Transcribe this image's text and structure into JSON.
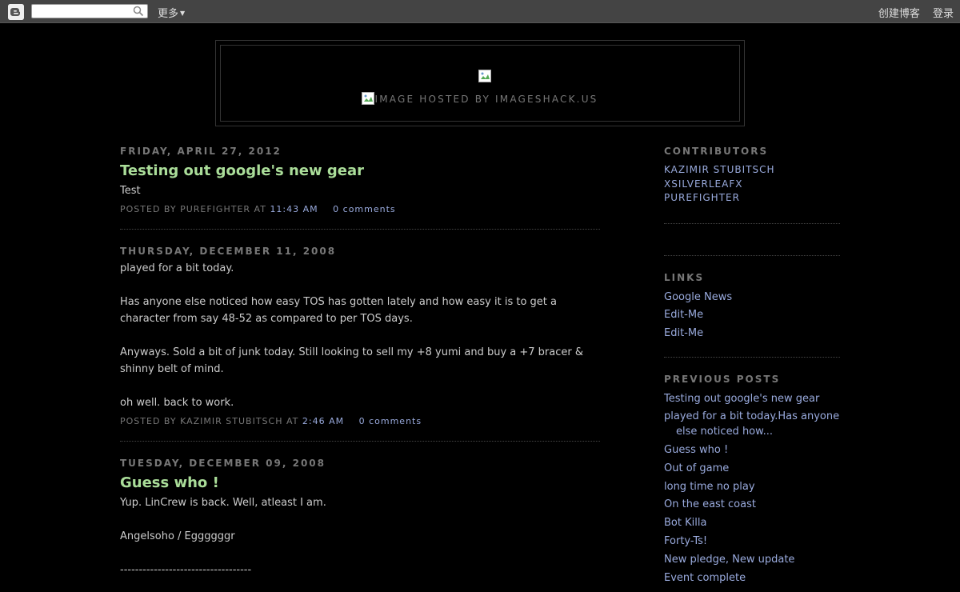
{
  "navbar": {
    "logo_icon": "blogger-icon",
    "search_placeholder": "",
    "more_label": "更多",
    "create_blog_label": "创建博客",
    "login_label": "登录"
  },
  "header": {
    "caption": "Image hosted by ImageShack.us"
  },
  "posts": [
    {
      "date": "Friday, April 27, 2012",
      "title": "Testing out google's new gear",
      "paragraphs": [
        "Test"
      ],
      "author_prefix": "Posted by",
      "author": "Purefighter",
      "at": "at",
      "time": "11:43 AM",
      "comments": "0 comments"
    },
    {
      "date": "Thursday, December 11, 2008",
      "title": "",
      "paragraphs": [
        "played for a bit today.",
        "Has anyone else noticed how easy TOS has gotten lately and how easy it is to get a character from say 48-52 as compared to per TOS days.",
        "Anyways. Sold a bit of junk today. Still looking to sell my +8 yumi and buy a +7 bracer & shinny belt of mind.",
        "oh well. back to work."
      ],
      "author_prefix": "Posted by",
      "author": "Kazimir Stubitsch",
      "at": "at",
      "time": "2:46 AM",
      "comments": "0 comments"
    },
    {
      "date": "Tuesday, December 09, 2008",
      "title": "Guess who !",
      "paragraphs": [
        "Yup. LinCrew is back. Well, atleast I am.",
        "Angelsoho / Eggggggr",
        "-----------------------------------"
      ]
    }
  ],
  "sidebar": {
    "contributors_title": "Contributors",
    "contributors": [
      "Kazimir Stubitsch",
      "xSilverLeafx",
      "Purefighter"
    ],
    "links_title": "Links",
    "links": [
      "Google News",
      "Edit-Me",
      "Edit-Me"
    ],
    "previous_title": "Previous Posts",
    "previous_posts": [
      "Testing out google's new gear",
      "played for a bit today.Has anyone else noticed how...",
      "Guess who !",
      "Out of game",
      "long time no play",
      "On the east coast",
      "Bot Killa",
      "Forty-Ts!",
      "New pledge, New update",
      "Event complete"
    ]
  },
  "colors": {
    "background": "#000000",
    "navbar": "#444444",
    "title": "#aadd99",
    "link": "#99aadd",
    "muted": "#777777",
    "text": "#cccccc"
  }
}
